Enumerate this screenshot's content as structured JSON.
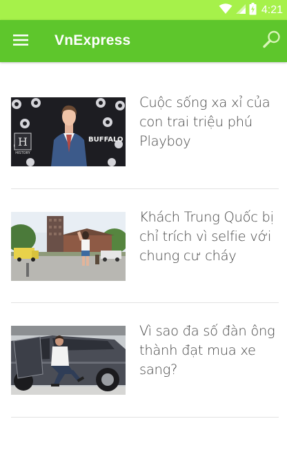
{
  "status_bar": {
    "time": "4:21",
    "icons": [
      "wifi-icon",
      "signal-icon",
      "battery-icon"
    ]
  },
  "app_bar": {
    "title": "VnExpress",
    "menu_icon": "hamburger-menu-icon",
    "search_icon": "search-icon",
    "color": "#5ec62c"
  },
  "articles": [
    {
      "headline": "Cuộc sống xa xỉ của con trai triệu phú Playboy"
    },
    {
      "headline": "Khách Trung Quốc bị chỉ trích vì selfie với chung cư cháy"
    },
    {
      "headline": "Vì sao đa số đàn ông thành đạt mua xe sang?"
    }
  ],
  "photo_text": {
    "history_logo": "HISTORY",
    "buffalo_sign": "BUFFALO"
  }
}
